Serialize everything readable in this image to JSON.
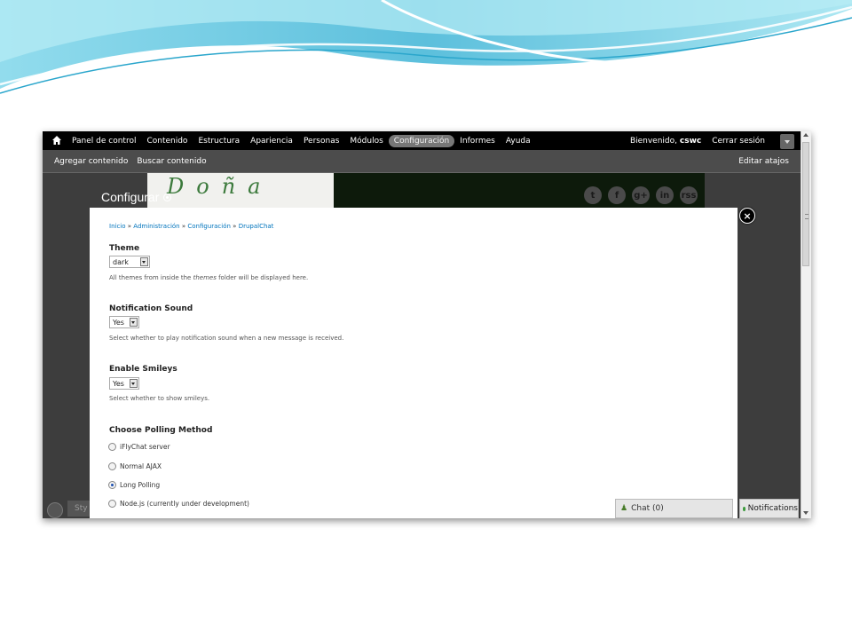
{
  "toolbar": {
    "menu": [
      "Panel de control",
      "Contenido",
      "Estructura",
      "Apariencia",
      "Personas",
      "Módulos",
      "Configuración",
      "Informes",
      "Ayuda"
    ],
    "active_item": "Configuración",
    "welcome_prefix": "Bienvenido,",
    "username": "cswc",
    "logout": "Cerrar sesión"
  },
  "shortcuts": {
    "add_content": "Agregar contenido",
    "find_content": "Buscar contenido",
    "edit_shortcuts": "Editar atajos"
  },
  "site": {
    "logo_text": "Doña",
    "page_title": "Configurar",
    "social": [
      "t",
      "f",
      "g+",
      "in",
      "rss"
    ]
  },
  "overlay": {
    "breadcrumb": [
      "Inicio",
      "Administración",
      "Configuración",
      "DrupalChat"
    ],
    "theme": {
      "label": "Theme",
      "value": "dark",
      "desc_before": "All themes from inside the ",
      "desc_em": "themes",
      "desc_after": " folder will be displayed here."
    },
    "notification_sound": {
      "label": "Notification Sound",
      "value": "Yes",
      "desc": "Select whether to play notification sound when a new message is received."
    },
    "smileys": {
      "label": "Enable Smileys",
      "value": "Yes",
      "desc": "Select whether to show smileys."
    },
    "polling": {
      "label": "Choose Polling Method",
      "options": [
        "iFlyChat server",
        "Normal AJAX",
        "Long Polling",
        "Node.js (currently under development)"
      ],
      "selected_index": 2
    }
  },
  "chat": {
    "chat_label": "Chat (0)",
    "notifications_label": "Notifications"
  },
  "bottom_left": {
    "tab_text": "Sty"
  },
  "colors": {
    "toolbar_bg": "#000000",
    "shortcuts_bg": "#4c4c4c",
    "link": "#0074bd",
    "wave": "#5bc0de"
  }
}
